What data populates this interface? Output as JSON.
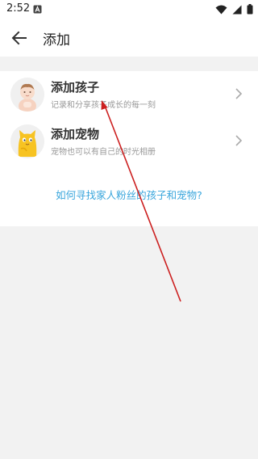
{
  "status_bar": {
    "time": "2:52",
    "icons": [
      "a-notification-icon",
      "wifi-icon",
      "signal-icon",
      "battery-icon"
    ]
  },
  "header": {
    "back_icon": "arrow-left-icon",
    "title": "添加"
  },
  "options": [
    {
      "title": "添加孩子",
      "subtitle": "记录和分享孩子成长的每一刻",
      "avatar_icon": "baby-avatar-icon"
    },
    {
      "title": "添加宠物",
      "subtitle": "宠物也可以有自己的时光相册",
      "avatar_icon": "cat-avatar-icon"
    }
  ],
  "help_link": "如何寻找家人粉丝的孩子和宠物?",
  "colors": {
    "link": "#3aa6dc",
    "annotation_arrow": "#cc1f1f",
    "background": "#f2f2f2"
  }
}
